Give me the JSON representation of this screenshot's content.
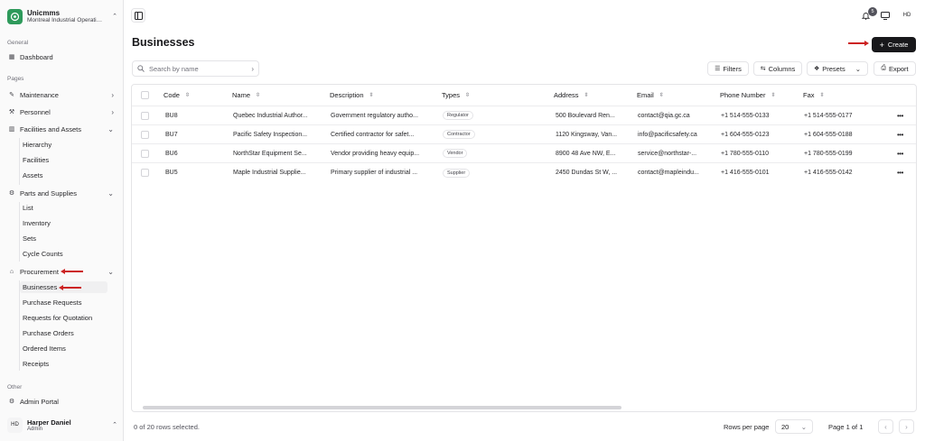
{
  "sidebar": {
    "org_name": "Unicmms",
    "org_sub": "Montreal Industrial Operations",
    "general_label": "General",
    "dashboard": "Dashboard",
    "pages_label": "Pages",
    "maintenance": "Maintenance",
    "personnel": "Personnel",
    "facilities_assets": "Facilities and Assets",
    "facilities_sub": [
      "Hierarchy",
      "Facilities",
      "Assets"
    ],
    "parts_supplies": "Parts and Supplies",
    "parts_sub": [
      "List",
      "Inventory",
      "Sets",
      "Cycle Counts"
    ],
    "procurement": "Procurement",
    "procurement_sub": [
      "Businesses",
      "Purchase Requests",
      "Requests for Quotation",
      "Purchase Orders",
      "Ordered Items",
      "Receipts"
    ],
    "other_label": "Other",
    "admin_portal": "Admin Portal",
    "user_initials": "HD",
    "user_name": "Harper Daniel",
    "user_role": "Admin"
  },
  "topbar": {
    "notification_count": "5",
    "user_initials": "HD"
  },
  "page": {
    "title": "Businesses",
    "create_label": "Create",
    "search_placeholder": "Search by name",
    "filters_label": "Filters",
    "columns_label": "Columns",
    "presets_label": "Presets",
    "export_label": "Export"
  },
  "table": {
    "headers": [
      "Code",
      "Name",
      "Description",
      "Types",
      "Address",
      "Email",
      "Phone Number",
      "Fax"
    ],
    "rows": [
      {
        "code": "BU8",
        "name": "Quebec Industrial Author...",
        "description": "Government regulatory autho...",
        "type": "Regulator",
        "address": "500 Boulevard Ren...",
        "email": "contact@qia.gc.ca",
        "phone": "+1 514-555-0133",
        "fax": "+1 514-555-0177"
      },
      {
        "code": "BU7",
        "name": "Pacific Safety Inspection...",
        "description": "Certified contractor for safet...",
        "type": "Contractor",
        "address": "1120 Kingsway, Van...",
        "email": "info@pacificsafety.ca",
        "phone": "+1 604-555-0123",
        "fax": "+1 604-555-0188"
      },
      {
        "code": "BU6",
        "name": "NorthStar Equipment Se...",
        "description": "Vendor providing heavy equip...",
        "type": "Vendor",
        "address": "8900 48 Ave NW, E...",
        "email": "service@northstar-...",
        "phone": "+1 780-555-0110",
        "fax": "+1 780-555-0199"
      },
      {
        "code": "BU5",
        "name": "Maple Industrial Supplie...",
        "description": "Primary supplier of industrial ...",
        "type": "Supplier",
        "address": "2450 Dundas St W, ...",
        "email": "contact@mapleindu...",
        "phone": "+1 416-555-0101",
        "fax": "+1 416-555-0142"
      }
    ]
  },
  "footer": {
    "selected": "0 of 20 rows selected.",
    "rows_per_page_label": "Rows per page",
    "rows_per_page_value": "20",
    "page_label": "Page 1 of 1"
  },
  "colors": {
    "accent": "#18181b",
    "annotation": "#cc2222",
    "logo": "#2e9a5b"
  }
}
